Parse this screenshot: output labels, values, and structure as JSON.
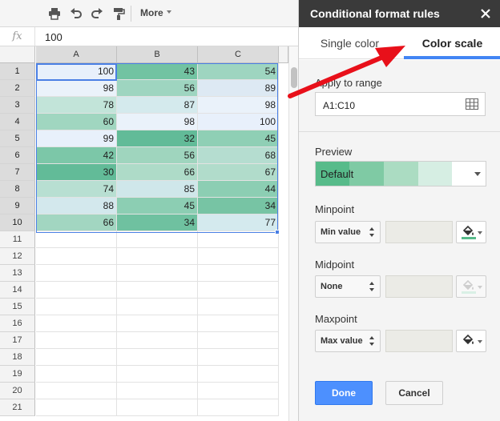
{
  "toolbar": {
    "icons": [
      "print-icon",
      "undo-icon",
      "redo-icon",
      "paint-format-icon"
    ],
    "more_label": "More"
  },
  "formula_bar": {
    "fx_label": "fx",
    "value": "100"
  },
  "sheet": {
    "columns": [
      "A",
      "B",
      "C"
    ],
    "rows": [
      "1",
      "2",
      "3",
      "4",
      "5",
      "6",
      "7",
      "8",
      "9",
      "10",
      "11",
      "12",
      "13",
      "14",
      "15",
      "16",
      "17",
      "18",
      "19",
      "20",
      "21"
    ],
    "cells": [
      [
        "100",
        "43",
        "54"
      ],
      [
        "98",
        "56",
        "89"
      ],
      [
        "78",
        "87",
        "98"
      ],
      [
        "60",
        "98",
        "100"
      ],
      [
        "99",
        "32",
        "45"
      ],
      [
        "42",
        "56",
        "68"
      ],
      [
        "30",
        "66",
        "67"
      ],
      [
        "74",
        "85",
        "44"
      ],
      [
        "88",
        "45",
        "34"
      ],
      [
        "66",
        "34",
        "77"
      ]
    ],
    "cell_colors": [
      [
        "#e8f0fb",
        "#72c3a2",
        "#9ed5c0"
      ],
      [
        "#eaf2fa",
        "#9ed5c0",
        "#dde9f3"
      ],
      [
        "#c2e4d9",
        "#d4eaed",
        "#eaf2fa"
      ],
      [
        "#a0d6c0",
        "#eaf2fa",
        "#e8f0fb"
      ],
      [
        "#e8f0fb",
        "#62bb98",
        "#8fcfb5"
      ],
      [
        "#7cc7a8",
        "#9fd5be",
        "#b5ddd0"
      ],
      [
        "#62bb98",
        "#aedbc8",
        "#b1dccb"
      ],
      [
        "#b8dfd2",
        "#cfe7ea",
        "#8cceb3"
      ],
      [
        "#d3e8ed",
        "#8cceb3",
        "#77c4a4"
      ],
      [
        "#a2d6c1",
        "#6fc1a0",
        "#d4eaee"
      ]
    ],
    "selection": "A1:C10"
  },
  "panel": {
    "title": "Conditional format rules",
    "tabs": [
      "Single color",
      "Color scale"
    ],
    "active_tab": "Color scale",
    "apply_label": "Apply to range",
    "range_value": "A1:C10",
    "preview_label": "Preview",
    "preview_value": "Default",
    "preview_colors": [
      "#57bb8a",
      "#7fcaa4",
      "#abdcc2",
      "#d6eee3",
      "#ffffff"
    ],
    "minpoint": {
      "label": "Minpoint",
      "type": "Min value",
      "color": "#57bb8a"
    },
    "midpoint": {
      "label": "Midpoint",
      "type": "None",
      "color": "#d9f0e5"
    },
    "maxpoint": {
      "label": "Maxpoint",
      "type": "Max value",
      "color": "#ffffff"
    },
    "done_label": "Done",
    "cancel_label": "Cancel"
  },
  "colors": {
    "panel_header": "#3a3a3a",
    "accent_blue": "#4285f4",
    "arrow_red": "#e8101a"
  }
}
